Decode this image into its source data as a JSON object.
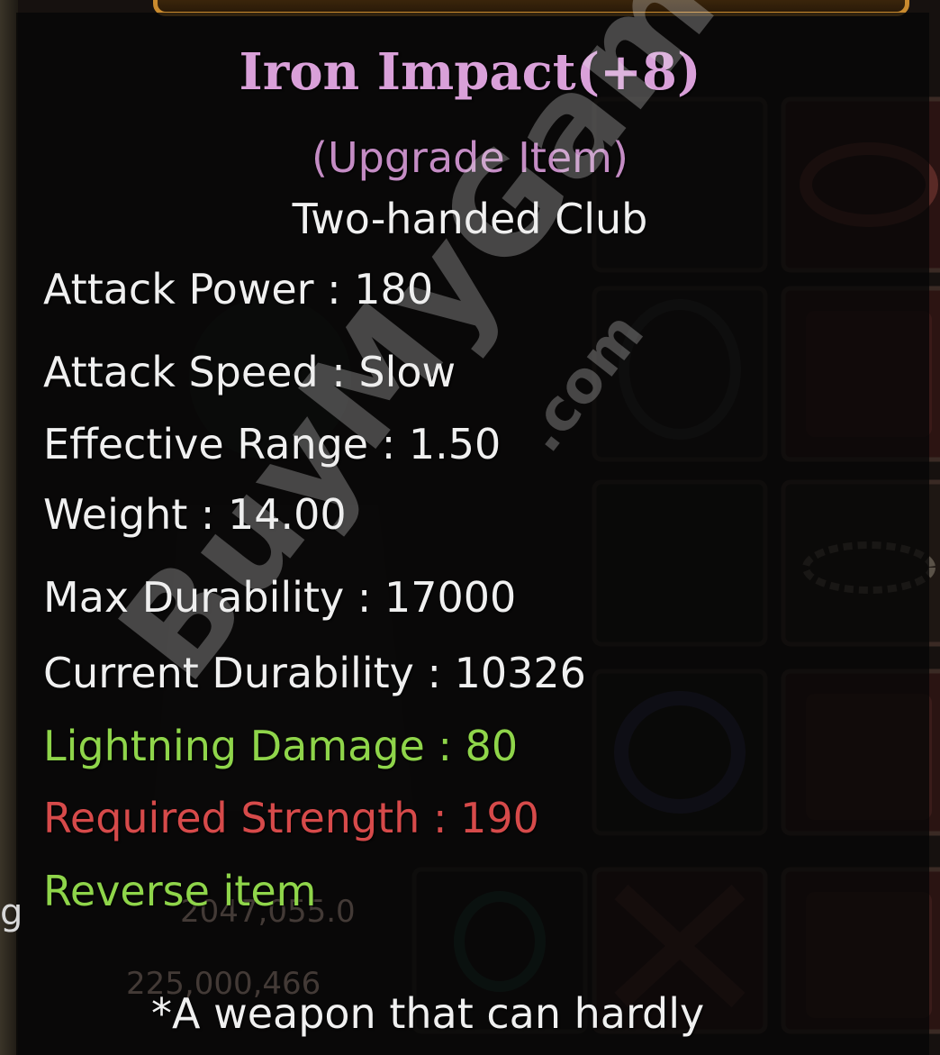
{
  "item": {
    "name": "Iron Impact(+8)",
    "upgrade_tag": "(Upgrade Item)",
    "item_type": "Two-handed Club",
    "description": "*A weapon that can hardly"
  },
  "stats": [
    {
      "text": "Attack Power : 180",
      "color": "#f0f0f0"
    },
    {
      "text": "Attack Speed : Slow",
      "color": "#f0f0f0"
    },
    {
      "text": "Effective Range : 1.50",
      "color": "#f0f0f0"
    },
    {
      "text": "Weight : 14.00",
      "color": "#f0f0f0"
    },
    {
      "text": "Max Durability : 17000",
      "color": "#f0f0f0"
    },
    {
      "text": "Current Durability : 10326",
      "color": "#f0f0f0"
    },
    {
      "text": "Lightning Damage : 80",
      "color": "#8fd54a"
    },
    {
      "text": "Required Strength : 190",
      "color": "#d64a4a"
    },
    {
      "text": "Reverse item",
      "color": "#8fd54a"
    }
  ],
  "colors": {
    "name": "#d9a0d9",
    "upgrade_tag": "#c48cc4",
    "item_type": "#f0f0f0",
    "description": "#f0f0f0",
    "frame_gold": "#c98a2e"
  },
  "watermark": {
    "brand": "BuyMyGame",
    "suffix": ".com"
  },
  "background_numbers": {
    "partial": "2047,055.0",
    "gold": "225,000,466",
    "edge_glyph": "g"
  }
}
